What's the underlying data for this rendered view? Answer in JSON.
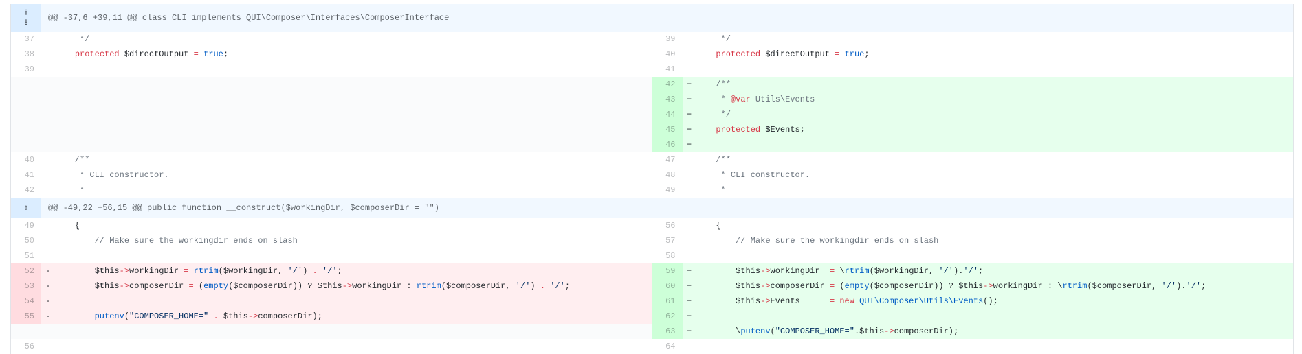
{
  "hunks": [
    {
      "header": "@@ -37,6 +39,11 @@ class CLI implements QUI\\Composer\\Interfaces\\ComposerInterface"
    },
    {
      "header": "@@ -49,22 +56,15 @@ public function __construct($workingDir, $composerDir = \"\")"
    }
  ],
  "left": {
    "h1": [
      {
        "ln": "37",
        "mk": "",
        "code": "     */"
      },
      {
        "ln": "38",
        "mk": "",
        "code": "    protected $directOutput = true;"
      },
      {
        "ln": "39",
        "mk": "",
        "code": ""
      },
      {
        "ln": "",
        "mk": "",
        "code": ""
      },
      {
        "ln": "",
        "mk": "",
        "code": ""
      },
      {
        "ln": "",
        "mk": "",
        "code": ""
      },
      {
        "ln": "",
        "mk": "",
        "code": ""
      },
      {
        "ln": "",
        "mk": "",
        "code": ""
      },
      {
        "ln": "40",
        "mk": "",
        "code": "    /**"
      },
      {
        "ln": "41",
        "mk": "",
        "code": "     * CLI constructor."
      },
      {
        "ln": "42",
        "mk": "",
        "code": "     *"
      }
    ],
    "h2": [
      {
        "ln": "49",
        "mk": "",
        "code": "    {"
      },
      {
        "ln": "50",
        "mk": "",
        "code": "        // Make sure the workingdir ends on slash"
      },
      {
        "ln": "51",
        "mk": "",
        "code": ""
      },
      {
        "ln": "52",
        "mk": "-",
        "code": "        $this->workingDir = rtrim($workingDir, '/') . '/';"
      },
      {
        "ln": "53",
        "mk": "-",
        "code": "        $this->composerDir = (empty($composerDir)) ? $this->workingDir : rtrim($composerDir, '/') . '/';"
      },
      {
        "ln": "54",
        "mk": "-",
        "code": ""
      },
      {
        "ln": "55",
        "mk": "-",
        "code": "        putenv(\"COMPOSER_HOME=\" . $this->composerDir);"
      },
      {
        "ln": "",
        "mk": "",
        "code": ""
      },
      {
        "ln": "56",
        "mk": "",
        "code": ""
      }
    ]
  },
  "right": {
    "h1": [
      {
        "ln": "39",
        "mk": "",
        "code": "     */"
      },
      {
        "ln": "40",
        "mk": "",
        "code": "    protected $directOutput = true;"
      },
      {
        "ln": "41",
        "mk": "",
        "code": ""
      },
      {
        "ln": "42",
        "mk": "+",
        "code": "    /**"
      },
      {
        "ln": "43",
        "mk": "+",
        "code": "     * @var Utils\\Events"
      },
      {
        "ln": "44",
        "mk": "+",
        "code": "     */"
      },
      {
        "ln": "45",
        "mk": "+",
        "code": "    protected $Events;"
      },
      {
        "ln": "46",
        "mk": "+",
        "code": ""
      },
      {
        "ln": "47",
        "mk": "",
        "code": "    /**"
      },
      {
        "ln": "48",
        "mk": "",
        "code": "     * CLI constructor."
      },
      {
        "ln": "49",
        "mk": "",
        "code": "     *"
      }
    ],
    "h2": [
      {
        "ln": "56",
        "mk": "",
        "code": "    {"
      },
      {
        "ln": "57",
        "mk": "",
        "code": "        // Make sure the workingdir ends on slash"
      },
      {
        "ln": "58",
        "mk": "",
        "code": ""
      },
      {
        "ln": "59",
        "mk": "+",
        "code": "        $this->workingDir  = \\rtrim($workingDir, '/').'/';"
      },
      {
        "ln": "60",
        "mk": "+",
        "code": "        $this->composerDir = (empty($composerDir)) ? $this->workingDir : \\rtrim($composerDir, '/').'/';"
      },
      {
        "ln": "61",
        "mk": "+",
        "code": "        $this->Events      = new QUI\\Composer\\Utils\\Events();"
      },
      {
        "ln": "62",
        "mk": "+",
        "code": ""
      },
      {
        "ln": "63",
        "mk": "+",
        "code": "        \\putenv(\"COMPOSER_HOME=\".$this->composerDir);"
      },
      {
        "ln": "64",
        "mk": "",
        "code": ""
      }
    ]
  },
  "icons": {
    "expand_up": "fold-up-icon",
    "expand_down": "fold-down-icon",
    "expand_both": "unfold-icon"
  },
  "colors": {
    "addition_bg": "#e6ffed",
    "addition_ln_bg": "#cdffd8",
    "deletion_bg": "#ffeef0",
    "deletion_ln_bg": "#ffdce0",
    "hunk_bg": "#f1f8ff",
    "expander_bg": "#dbedff"
  }
}
